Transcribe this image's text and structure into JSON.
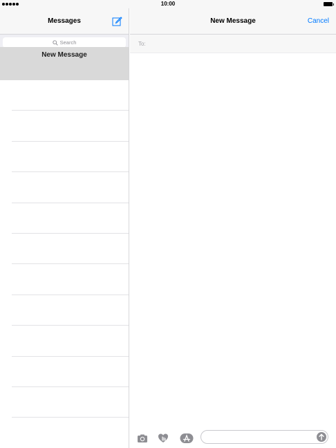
{
  "status_bar": {
    "time": "10:00"
  },
  "left_panel": {
    "title": "Messages",
    "search_placeholder": "Search",
    "selected_item_label": "New Message",
    "empty_rows": 11
  },
  "right_panel": {
    "title": "New Message",
    "cancel_label": "Cancel",
    "to_label": "To:"
  },
  "compose_bar": {
    "icons": [
      "camera-icon",
      "digital-touch-icon",
      "app-store-icon",
      "send-icon"
    ]
  },
  "colors": {
    "accent": "#007aff",
    "nav_background": "#f7f7f7",
    "selected_row": "#d9d9d9",
    "icon_gray": "#8e8e93"
  }
}
